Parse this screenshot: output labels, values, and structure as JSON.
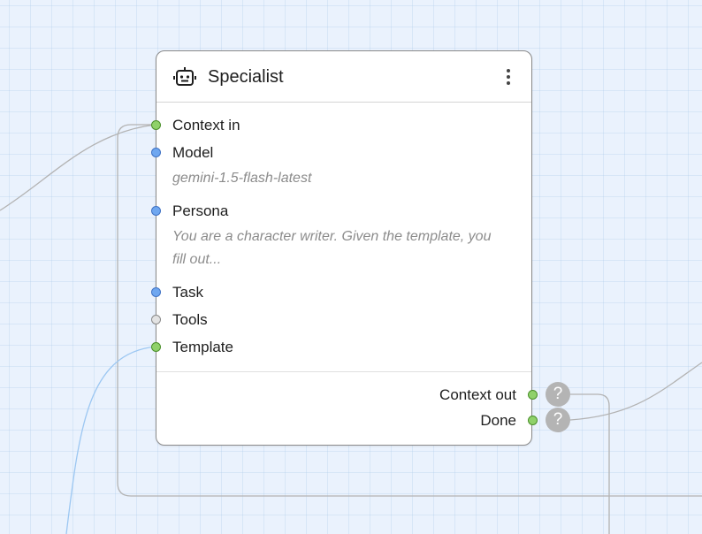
{
  "node": {
    "title": "Specialist",
    "icon": "robot-icon",
    "menu_icon": "more-vertical-icon",
    "inputs": [
      {
        "label": "Context in",
        "color": "#8fd16a"
      },
      {
        "label": "Model",
        "color": "#6fa7f0",
        "value": "gemini-1.5-flash-latest"
      },
      {
        "label": "Persona",
        "color": "#6fa7f0",
        "value": "You are a character writer. Given the template, you fill out..."
      },
      {
        "label": "Task",
        "color": "#6fa7f0"
      },
      {
        "label": "Tools",
        "color": "#e3e3e3"
      },
      {
        "label": "Template",
        "color": "#8fd16a"
      }
    ],
    "outputs": [
      {
        "label": "Context out",
        "color": "#8fd16a",
        "badge": "?"
      },
      {
        "label": "Done",
        "color": "#8fd16a",
        "badge": "?"
      }
    ]
  },
  "colors": {
    "canvas": "#eaf2fd",
    "wire_gray": "#b3b3b3",
    "wire_blue": "#9cc7f2"
  }
}
